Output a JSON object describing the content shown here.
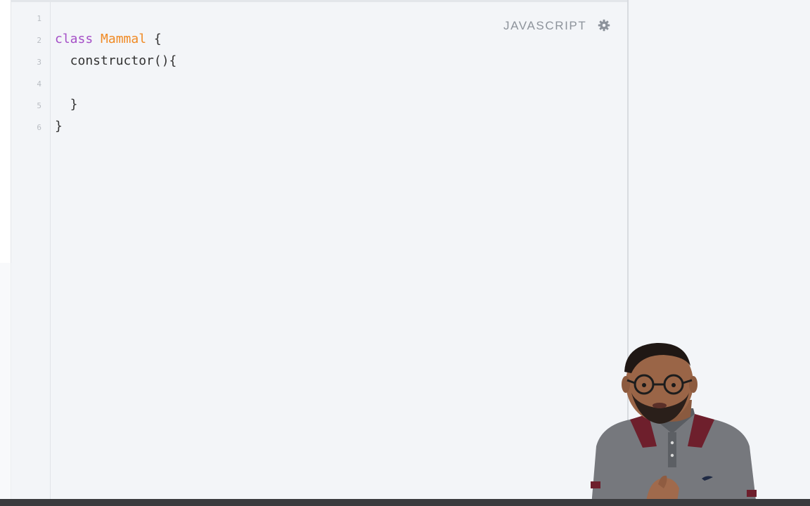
{
  "editor": {
    "language_label": "JAVASCRIPT",
    "settings_icon": "gear-icon",
    "line_numbers": [
      "1",
      "2",
      "3",
      "4",
      "5",
      "6"
    ],
    "code": {
      "line2_keyword": "class",
      "line2_space": " ",
      "line2_classname": "Mammal",
      "line2_rest": " {",
      "line3": "  constructor(){",
      "line4": "",
      "line5": "  }",
      "line6": "}"
    }
  },
  "colors": {
    "keyword": "#a54fc7",
    "class_name": "#f08a24",
    "text": "#333333",
    "background": "#f3f5f8"
  },
  "overlay": {
    "presenter": "presenter-video"
  }
}
